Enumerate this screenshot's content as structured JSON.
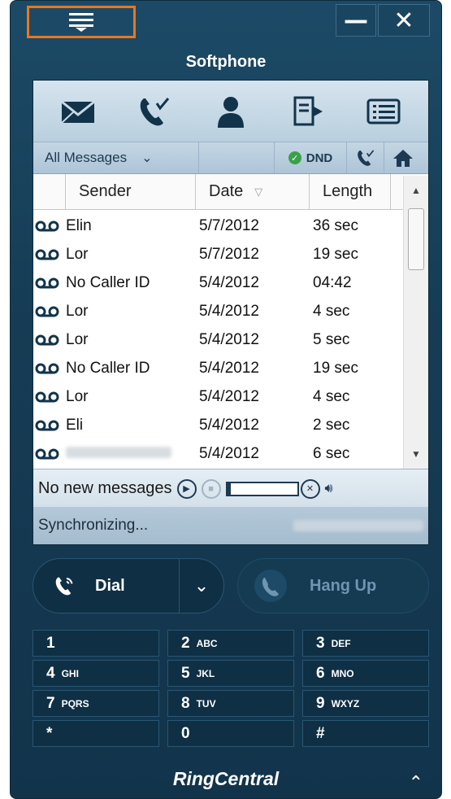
{
  "window": {
    "title": "Softphone",
    "minimize_label": "—",
    "close_label": "✕"
  },
  "filter": {
    "selected": "All Messages",
    "dnd_label": "DND"
  },
  "table": {
    "headers": {
      "sender": "Sender",
      "date": "Date",
      "length": "Length"
    },
    "rows": [
      {
        "sender": "Elin",
        "date": "5/7/2012",
        "length": "36 sec"
      },
      {
        "sender": "Lor",
        "date": "5/7/2012",
        "length": "19 sec"
      },
      {
        "sender": "No Caller ID",
        "date": "5/4/2012",
        "length": "04:42"
      },
      {
        "sender": "Lor",
        "date": "5/4/2012",
        "length": "4 sec"
      },
      {
        "sender": "Lor",
        "date": "5/4/2012",
        "length": "5 sec"
      },
      {
        "sender": "No Caller ID",
        "date": "5/4/2012",
        "length": "19 sec"
      },
      {
        "sender": "Lor",
        "date": "5/4/2012",
        "length": "4 sec"
      },
      {
        "sender": "Eli",
        "date": "5/4/2012",
        "length": "2 sec"
      },
      {
        "sender": "",
        "date": "5/4/2012",
        "length": "6 sec"
      }
    ]
  },
  "player": {
    "status": "No new messages"
  },
  "status": {
    "text": "Synchronizing..."
  },
  "calls": {
    "dial_label": "Dial",
    "hangup_label": "Hang Up"
  },
  "keypad": [
    {
      "num": "1",
      "letters": ""
    },
    {
      "num": "2",
      "letters": "ABC"
    },
    {
      "num": "3",
      "letters": "DEF"
    },
    {
      "num": "4",
      "letters": "GHI"
    },
    {
      "num": "5",
      "letters": "JKL"
    },
    {
      "num": "6",
      "letters": "MNO"
    },
    {
      "num": "7",
      "letters": "PQRS"
    },
    {
      "num": "8",
      "letters": "TUV"
    },
    {
      "num": "9",
      "letters": "WXYZ"
    },
    {
      "num": "*",
      "letters": ""
    },
    {
      "num": "0",
      "letters": ""
    },
    {
      "num": "#",
      "letters": ""
    }
  ],
  "brand": "RingCentral",
  "colors": {
    "accent": "#e87722",
    "background": "#163c55",
    "dnd_green": "#3aa14a"
  }
}
